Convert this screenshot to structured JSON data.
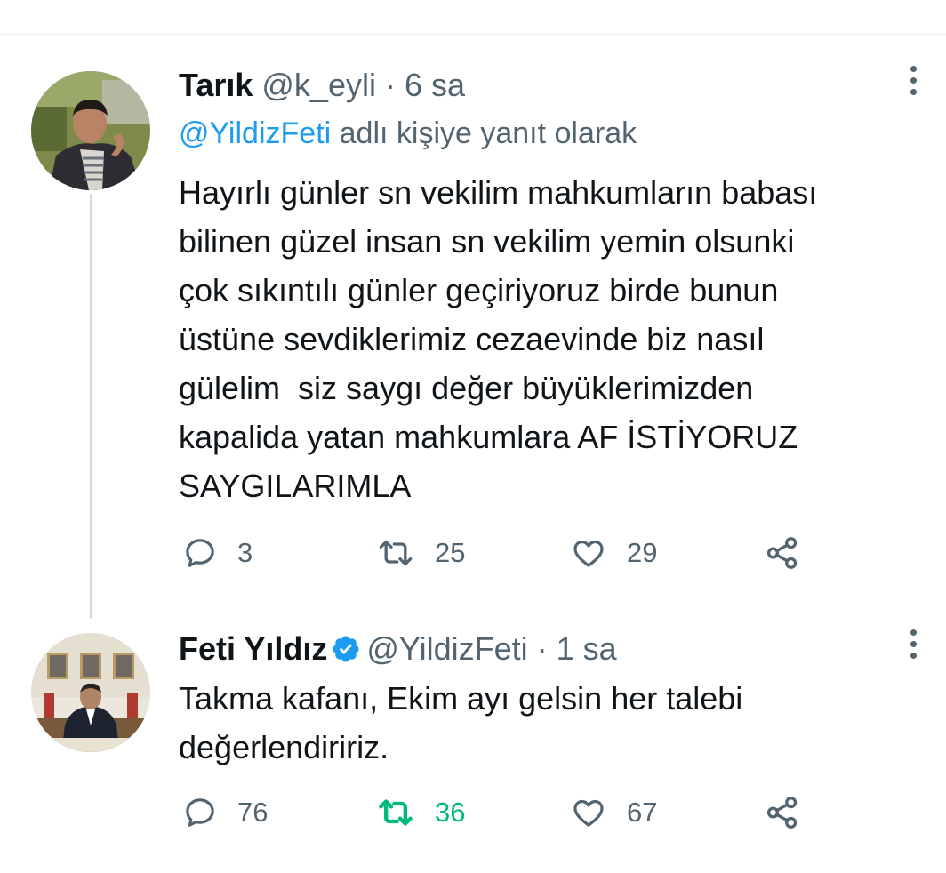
{
  "tweets": [
    {
      "name": "Tarık",
      "handle": "@k_eyli",
      "dot": "·",
      "time": "6 sa",
      "reply_to": "@YildizFeti",
      "reply_suffix": " adlı kişiye yanıt olarak",
      "text": "Hayırlı günler sn vekilim mahkumların babası\nbilinen güzel insan sn vekilim yemin olsunki\nçok sıkıntılı günler geçiriyoruz birde bunun\nüstüne sevdiklerimiz cezaevinde biz nasıl\ngülelim  siz saygı değer büyüklerimizden\nkapalida yatan mahkumlara AF İSTİYORUZ\nSAYGILARIMLA",
      "replies": "3",
      "retweets": "25",
      "likes": "29"
    },
    {
      "name": "Feti Yıldız",
      "verified": true,
      "handle": "@YildizFeti",
      "dot": "·",
      "time": "1 sa",
      "text": "Takma kafanı, Ekim ayı gelsin her talebi\ndeğerlendiririz.",
      "replies": "76",
      "retweets": "36",
      "likes": "67",
      "retweeted": true
    }
  ],
  "colors": {
    "accent": "#1d9bf0",
    "retweet_active": "#00ba7c",
    "muted": "#536471",
    "thread_line": "#cfd9de"
  },
  "icons": [
    "more-icon",
    "reply-icon",
    "retweet-icon",
    "like-icon",
    "share-icon",
    "verified-badge-icon"
  ]
}
